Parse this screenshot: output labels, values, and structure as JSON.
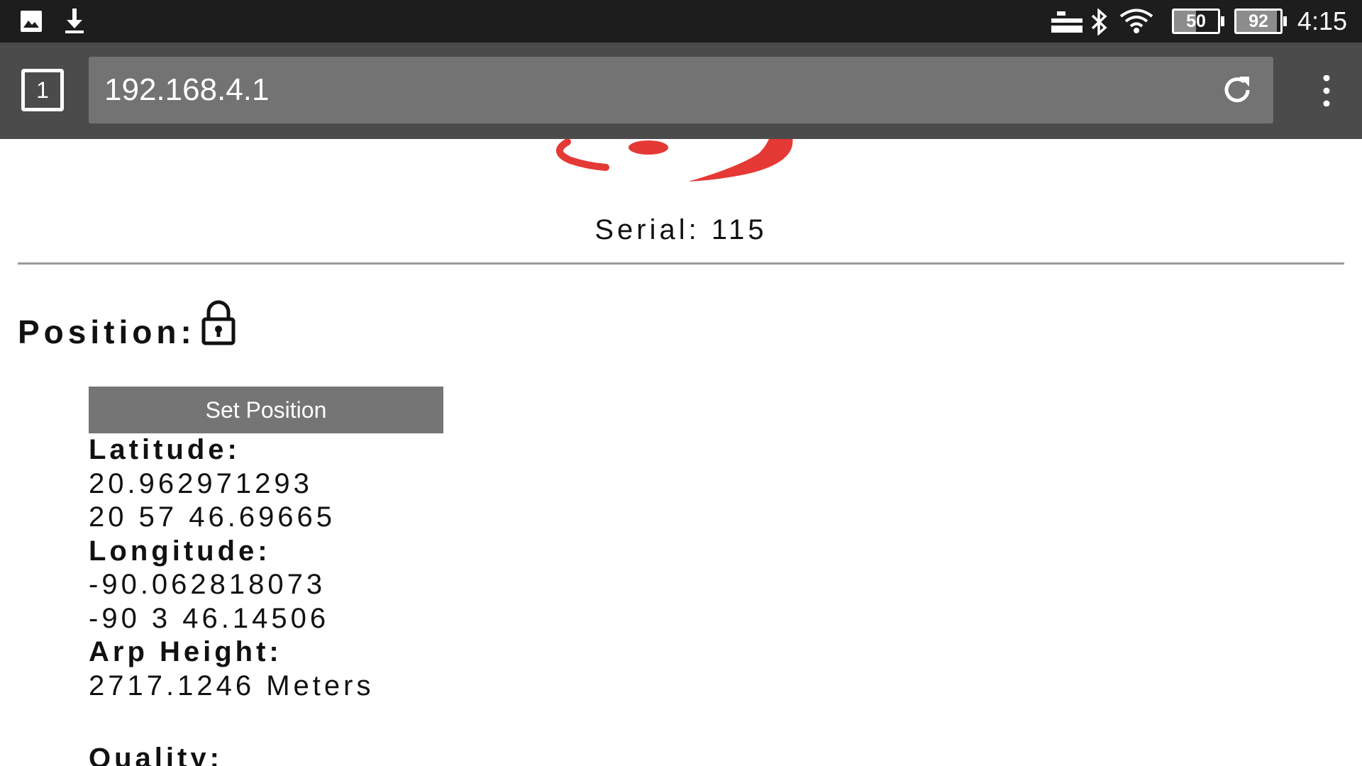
{
  "status_bar": {
    "left_icons": [
      "image-icon",
      "download-icon"
    ],
    "right_icons": [
      "keyboard-icon",
      "bluetooth-icon",
      "wifi-icon"
    ],
    "battery_1": {
      "level": "50",
      "fill": 0.5
    },
    "battery_2": {
      "level": "92",
      "fill": 0.92
    },
    "time": "4:15",
    "colors": {
      "background": "#1d1d1d",
      "foreground": "#ffffff"
    }
  },
  "browser": {
    "tab_count": "1",
    "url": "192.168.4.1",
    "reload_icon": "reload-icon",
    "menu_icon": "more-vert-icon",
    "colors": {
      "toolbar": "#4b4b4b",
      "url_bar": "#737373"
    }
  },
  "page": {
    "logo_color": "#e53935",
    "serial": "Serial: 115",
    "position_heading": "Position:",
    "lock_icon": "lock-icon",
    "set_position_button": "Set Position",
    "latitude": {
      "label": "Latitude:",
      "decimal": "20.962971293",
      "dms": "20 57 46.69665"
    },
    "longitude": {
      "label": "Longitude:",
      "decimal": "-90.062818073",
      "dms": "-90 3 46.14506"
    },
    "arp_height": {
      "label": "Arp Height:",
      "value": "2717.1246 Meters"
    },
    "quality": {
      "label": "Quality:"
    },
    "colors": {
      "button": "#757575",
      "divider": "#9a9a9a"
    }
  }
}
